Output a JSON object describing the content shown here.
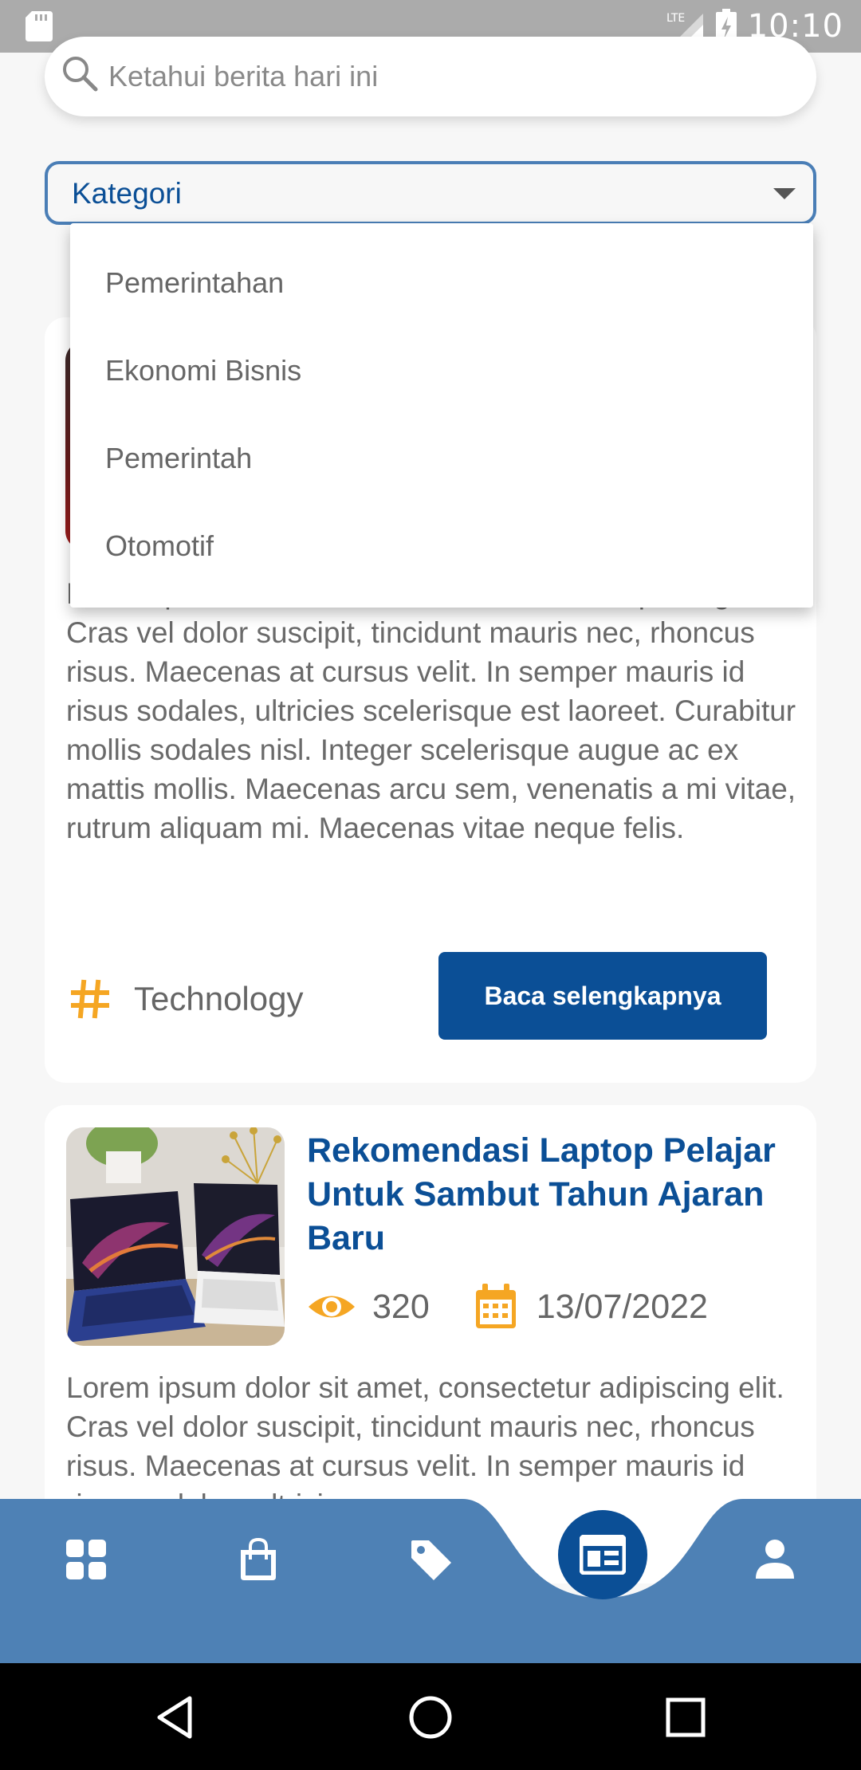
{
  "status_bar": {
    "time": "10:10",
    "network": "LTE"
  },
  "search": {
    "placeholder": "Ketahui berita hari ini"
  },
  "category": {
    "label": "Kategori",
    "options": [
      "Pemerintahan",
      "Ekonomi Bisnis",
      "Pemerintah",
      "Otomotif"
    ]
  },
  "articles": [
    {
      "body_partial_top": "Lorem ipsum dolor sit amet, consectetur",
      "body": "Lorem ipsum dolor sit amet, consectetur adipiscing elit. Cras vel dolor suscipit, tincidunt mauris nec, rhoncus risus. Maecenas at cursus velit. In semper mauris id risus sodales, ultricies scelerisque est laoreet. Curabitur mollis sodales nisl. Integer scelerisque augue ac ex mattis mollis. Maecenas arcu sem, venenatis a mi vitae, rutrum aliquam mi. Maecenas vitae neque felis.",
      "tag": "Technology",
      "read_more": "Baca selengkapnya"
    },
    {
      "title": "Rekomendasi Laptop Pelajar Untuk Sambut Tahun Ajaran Baru",
      "views": "320",
      "date": "13/07/2022",
      "body": "Lorem ipsum dolor sit amet, consectetur adipiscing elit. Cras vel dolor suscipit, tincidunt mauris nec, rhoncus risus. Maecenas at cursus velit. In semper mauris id risus sodales, ultricies"
    }
  ],
  "bottom_nav": {
    "items": [
      "dashboard-icon",
      "shopping-bag-icon",
      "tag-icon",
      "news-icon",
      "profile-icon"
    ],
    "active": "news-icon"
  },
  "colors": {
    "primary": "#0b4f96",
    "nav_bg": "#4e81b5",
    "accent": "#f5a623"
  }
}
